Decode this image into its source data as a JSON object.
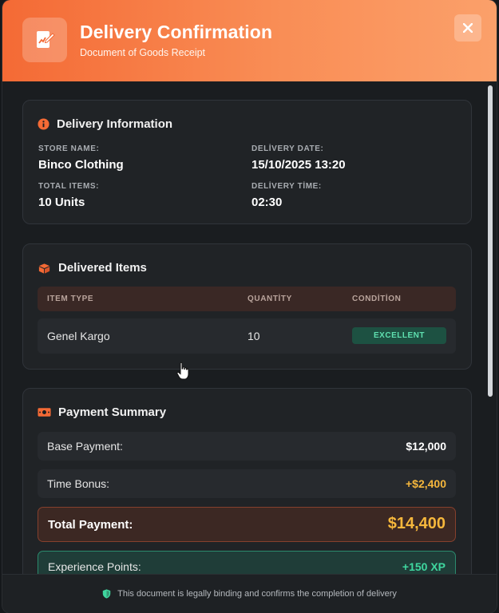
{
  "header": {
    "title": "Delivery Confirmation",
    "subtitle": "Document of Goods Receipt",
    "icon": "document-signature-icon",
    "close_icon": "close-icon",
    "accent_color": "#f46a35"
  },
  "delivery_info": {
    "title": "Delivery Information",
    "icon": "info-circle-icon",
    "store_name_label": "STORE NAME:",
    "store_name": "Binco Clothing",
    "delivery_date_label": "DELİVERY DATE:",
    "delivery_date": "15/10/2025 13:20",
    "total_items_label": "TOTAL ITEMS:",
    "total_items": "10 Units",
    "delivery_time_label": "DELİVERY TİME:",
    "delivery_time": "02:30"
  },
  "delivered_items": {
    "title": "Delivered Items",
    "icon": "boxes-icon",
    "columns": [
      "ITEM TYPE",
      "QUANTİTY",
      "CONDİTİON"
    ],
    "rows": [
      {
        "item_type": "Genel Kargo",
        "quantity": "10",
        "condition": "EXCELLENT"
      }
    ]
  },
  "payment_summary": {
    "title": "Payment Summary",
    "icon": "money-bill-icon",
    "base_label": "Base Payment:",
    "base_value": "$12,000",
    "bonus_label": "Time Bonus:",
    "bonus_value": "+$2,400",
    "total_label": "Total Payment:",
    "total_value": "$14,400",
    "xp_label": "Experience Points:",
    "xp_value": "+150 XP",
    "gold_color": "#f6b73c",
    "green_color": "#3fd79f"
  },
  "footer": {
    "text": "This document is legally binding and confirms the completion of delivery",
    "icon": "shield-icon"
  }
}
